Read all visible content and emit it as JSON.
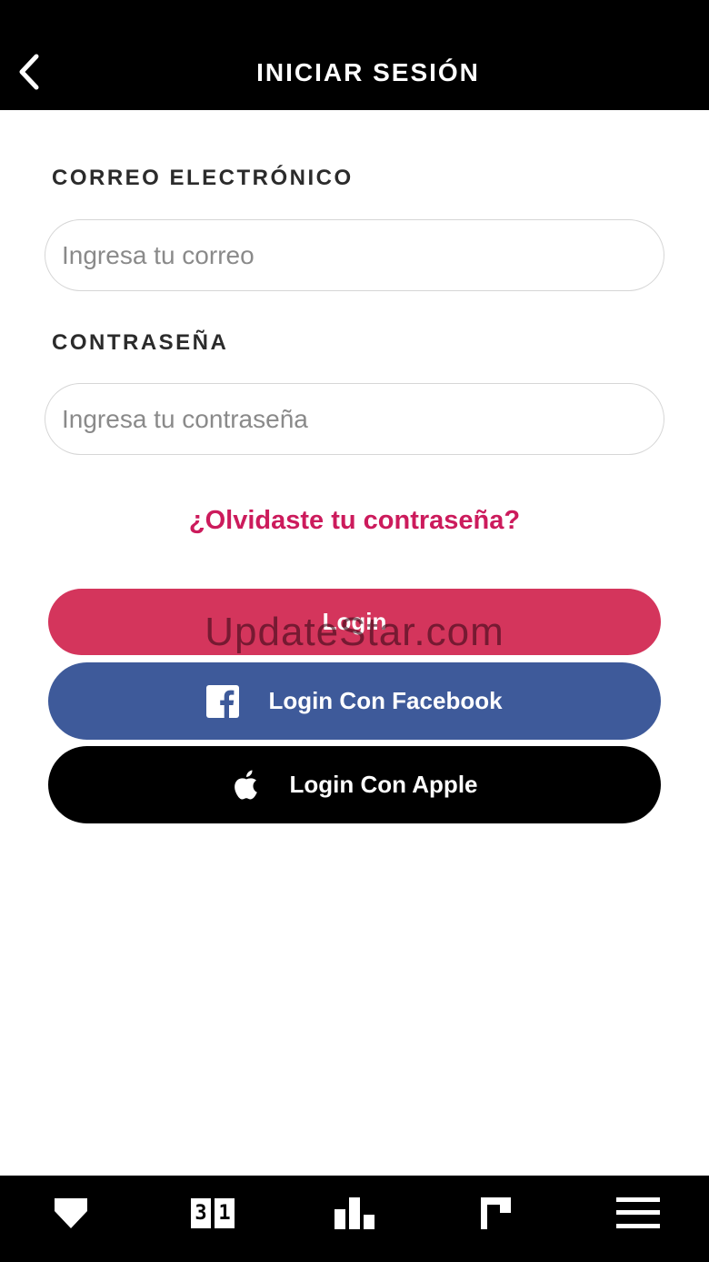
{
  "header": {
    "title": "INICIAR SESIÓN",
    "back_icon": "chevron-left-icon"
  },
  "form": {
    "email_label": "CORREO ELECTRÓNICO",
    "email_placeholder": "Ingresa tu correo",
    "email_value": "",
    "password_label": "CONTRASEÑA",
    "password_placeholder": "Ingresa tu contraseña",
    "password_value": "",
    "forgot_password": "¿Olvidaste tu contraseña?"
  },
  "buttons": {
    "login": "Login",
    "facebook": "Login Con Facebook",
    "apple": "Login Con Apple"
  },
  "watermark": "UpdateStar.com",
  "bottom_nav": {
    "items": [
      {
        "icon": "shield-icon"
      },
      {
        "icon": "calendar-icon",
        "digits": [
          "3",
          "1"
        ]
      },
      {
        "icon": "bar-chart-icon"
      },
      {
        "icon": "flag-icon"
      },
      {
        "icon": "menu-icon"
      }
    ]
  },
  "colors": {
    "accent": "#cc1b5c",
    "login_button": "#d4355c",
    "facebook_button": "#3e5a9a",
    "apple_button": "#000000",
    "header_background": "#000000"
  }
}
